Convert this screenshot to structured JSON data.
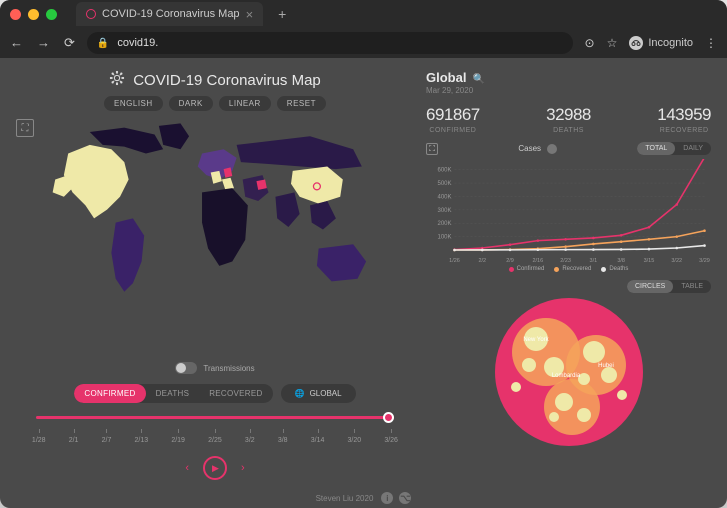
{
  "browser": {
    "tab_title": "COVID-19 Coronavirus Map",
    "new_tab": "+",
    "url": "covid19.",
    "incognito_label": "Incognito",
    "menu": "⋮"
  },
  "app": {
    "title": "COVID-19 Coronavirus Map",
    "options": {
      "lang": "ENGLISH",
      "theme": "DARK",
      "scale": "LINEAR",
      "reset": "RESET"
    },
    "transmissions_label": "Transmissions",
    "modes": {
      "confirmed": "CONFIRMED",
      "deaths": "DEATHS",
      "recovered": "RECOVERED"
    },
    "global_btn": "GLOBAL",
    "timeline": [
      "1/28",
      "2/1",
      "2/7",
      "2/13",
      "2/19",
      "2/25",
      "3/2",
      "3/8",
      "3/14",
      "3/20",
      "3/26"
    ]
  },
  "summary": {
    "title": "Global",
    "date": "Mar 29, 2020",
    "confirmed": {
      "value": "691867",
      "label": "CONFIRMED"
    },
    "deaths": {
      "value": "32988",
      "label": "DEATHS"
    },
    "recovered": {
      "value": "143959",
      "label": "RECOVERED"
    }
  },
  "chart": {
    "title": "Cases",
    "toggles": {
      "total": "TOTAL",
      "daily": "DAILY"
    },
    "yticks": [
      "600K",
      "500K",
      "400K",
      "300K",
      "200K",
      "100K"
    ],
    "xticks": [
      "1/26",
      "2/2",
      "2/9",
      "2/16",
      "2/23",
      "3/1",
      "3/8",
      "3/15",
      "3/22",
      "3/29"
    ],
    "legend": {
      "confirmed": "Confirmed",
      "recovered": "Recovered",
      "deaths": "Deaths"
    }
  },
  "bubble": {
    "toggles": {
      "circles": "CIRCLES",
      "table": "TABLE"
    },
    "labels": {
      "newyork": "New York",
      "lombardia": "Lombardia",
      "hubei": "Hubei"
    }
  },
  "footer": {
    "text": "Steven Liu 2020"
  },
  "colors": {
    "accent": "#e6336b",
    "orange": "#f5a35b",
    "light": "#efe9a8",
    "dark_purple": "#2d1b4e",
    "mid_purple": "#4a2d7a"
  },
  "chart_data": {
    "type": "line",
    "title": "Cases",
    "xlabel": "",
    "ylabel": "",
    "ylim": [
      0,
      650000
    ],
    "x": [
      "1/26",
      "2/2",
      "2/9",
      "2/16",
      "2/23",
      "3/1",
      "3/8",
      "3/15",
      "3/22",
      "3/29"
    ],
    "series": [
      {
        "name": "Confirmed",
        "color": "#e6336b",
        "values": [
          2000,
          15000,
          40000,
          70000,
          80000,
          90000,
          110000,
          170000,
          340000,
          691867
        ]
      },
      {
        "name": "Recovered",
        "color": "#f5a35b",
        "values": [
          50,
          500,
          3000,
          10000,
          25000,
          45000,
          62000,
          80000,
          100000,
          143959
        ]
      },
      {
        "name": "Deaths",
        "color": "#e8e8e8",
        "values": [
          50,
          300,
          900,
          1800,
          2800,
          3100,
          4000,
          7000,
          15000,
          32988
        ]
      }
    ]
  }
}
